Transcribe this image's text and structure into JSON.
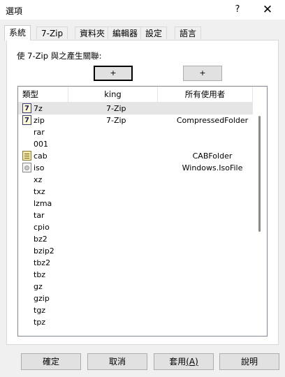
{
  "window": {
    "title": "選項"
  },
  "titlebar": {
    "help_glyph": "?",
    "close_glyph": "✕"
  },
  "tabs": [
    {
      "label": "系統",
      "active": true
    },
    {
      "label": "7-Zip"
    },
    {
      "label": "資料夾"
    },
    {
      "label": "編輯器"
    },
    {
      "label": "設定"
    },
    {
      "label": "語言"
    }
  ],
  "panel": {
    "assoc_label": "使 7-Zip 與之產生關聯:",
    "plus_button_1": "+",
    "plus_button_2": "+"
  },
  "table": {
    "columns": [
      "類型",
      "king",
      "所有使用者"
    ],
    "rows": [
      {
        "type": "7z",
        "king": "7-Zip",
        "all_users": "",
        "icon": "7zip-archive-icon",
        "selected": true
      },
      {
        "type": "zip",
        "king": "7-Zip",
        "all_users": "CompressedFolder",
        "icon": "7zip-archive-icon"
      },
      {
        "type": "rar",
        "king": "",
        "all_users": ""
      },
      {
        "type": "001",
        "king": "",
        "all_users": ""
      },
      {
        "type": "cab",
        "king": "",
        "all_users": "CABFolder",
        "icon": "cabinet-file-icon"
      },
      {
        "type": "iso",
        "king": "",
        "all_users": "Windows.IsoFile",
        "icon": "disc-image-icon"
      },
      {
        "type": "xz",
        "king": "",
        "all_users": ""
      },
      {
        "type": "txz",
        "king": "",
        "all_users": ""
      },
      {
        "type": "lzma",
        "king": "",
        "all_users": ""
      },
      {
        "type": "tar",
        "king": "",
        "all_users": ""
      },
      {
        "type": "cpio",
        "king": "",
        "all_users": ""
      },
      {
        "type": "bz2",
        "king": "",
        "all_users": ""
      },
      {
        "type": "bzip2",
        "king": "",
        "all_users": ""
      },
      {
        "type": "tbz2",
        "king": "",
        "all_users": ""
      },
      {
        "type": "tbz",
        "king": "",
        "all_users": ""
      },
      {
        "type": "gz",
        "king": "",
        "all_users": ""
      },
      {
        "type": "gzip",
        "king": "",
        "all_users": ""
      },
      {
        "type": "tgz",
        "king": "",
        "all_users": ""
      },
      {
        "type": "tpz",
        "king": "",
        "all_users": ""
      }
    ]
  },
  "footer": {
    "ok": "確定",
    "cancel": "取消",
    "apply": "套用",
    "apply_accel": "(A)",
    "help": "說明"
  }
}
